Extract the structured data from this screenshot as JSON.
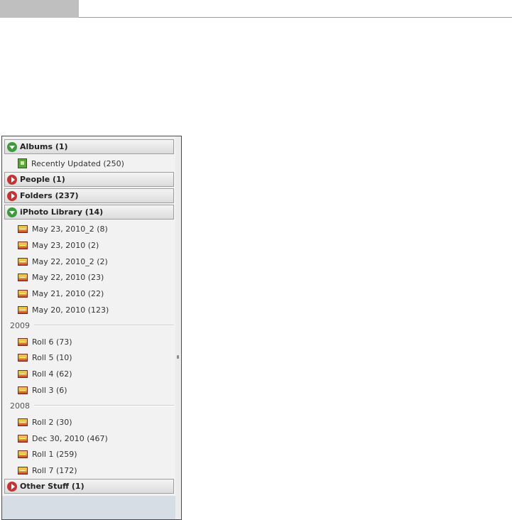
{
  "sidebar": {
    "sections": {
      "albums": {
        "label": "Albums (1)",
        "expanded": true
      },
      "people": {
        "label": "People (1)",
        "expanded": false
      },
      "folders": {
        "label": "Folders (237)",
        "expanded": false
      },
      "iphoto": {
        "label": "iPhoto Library (14)",
        "expanded": true
      },
      "other": {
        "label": "Other Stuff (1)",
        "expanded": false
      }
    },
    "album_items": [
      {
        "label": "Recently Updated (250)",
        "icon": "smart-album-icon"
      }
    ],
    "events_recent": [
      {
        "label": "May 23, 2010_2 (8)"
      },
      {
        "label": "May 23, 2010 (2)"
      },
      {
        "label": "May 22, 2010_2 (2)"
      },
      {
        "label": "May 22, 2010 (23)"
      },
      {
        "label": "May 21, 2010 (22)"
      },
      {
        "label": "May 20, 2010 (123)"
      }
    ],
    "year_2009": {
      "label": "2009",
      "items": [
        {
          "label": "Roll 6 (73)"
        },
        {
          "label": "Roll 5 (10)"
        },
        {
          "label": "Roll 4 (62)"
        },
        {
          "label": "Roll 3 (6)"
        }
      ]
    },
    "year_2008": {
      "label": "2008",
      "items": [
        {
          "label": "Roll 2 (30)"
        },
        {
          "label": "Dec 30, 2010 (467)"
        },
        {
          "label": "Roll 1 (259)"
        },
        {
          "label": "Roll 7 (172)"
        }
      ]
    }
  },
  "colors": {
    "expanded_disclosure": "#3d9a3d",
    "collapsed_disclosure": "#c73232",
    "panel_background": "#f2f2f2",
    "footer_background": "#d7dde5"
  }
}
